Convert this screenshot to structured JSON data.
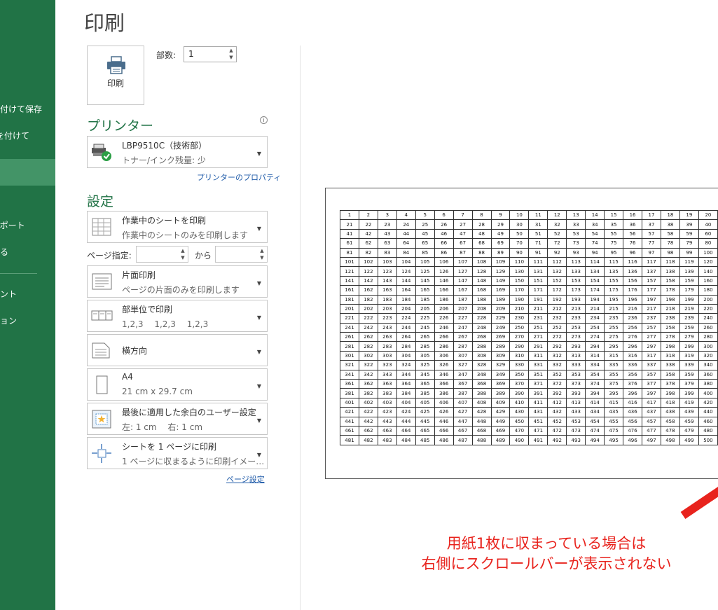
{
  "nav": {
    "items": [
      {
        "label": "名前を付けて保存",
        "active": false
      },
      {
        "label": "印刷を付けて",
        "active": false
      },
      {
        "label": "",
        "active": true
      },
      {
        "label": "エクスポート",
        "active": false
      },
      {
        "label": "閉じる",
        "active": false
      },
      {
        "label": "アカウント",
        "active": false
      },
      {
        "label": "オプション",
        "active": false
      }
    ]
  },
  "page_title": "印刷",
  "print_button": {
    "label": "印刷",
    "icon": "printer-icon"
  },
  "copies": {
    "label": "部数:",
    "value": "1"
  },
  "printer": {
    "heading": "プリンター",
    "name": "LBP9510C（技術部）",
    "status": "トナー/インク残量: 少",
    "properties_link": "プリンターのプロパティ"
  },
  "settings": {
    "heading": "設定",
    "what_to_print": {
      "title": "作業中のシートを印刷",
      "subtitle": "作業中のシートのみを印刷します"
    },
    "pages": {
      "label": "ページ指定:",
      "to_label": "から"
    },
    "sides": {
      "title": "片面印刷",
      "subtitle": "ページの片面のみを印刷します"
    },
    "collation": {
      "title": "部単位で印刷",
      "subtitle": "1,2,3　 1,2,3　 1,2,3"
    },
    "orientation": {
      "title": "横方向"
    },
    "paper_size": {
      "title": "A4",
      "subtitle": "21 cm x 29.7 cm"
    },
    "margins": {
      "title": "最後に適用した余白のユーザー設定",
      "subtitle": "左:  1 cm　 右:  1 cm"
    },
    "scaling": {
      "title": "シートを 1 ページに印刷",
      "subtitle": "1 ページに収まるように印刷イメー…"
    },
    "page_setup_link": "ページ設定"
  },
  "preview": {
    "rows": 25,
    "cols": 20
  },
  "annotation": {
    "line1": "用紙1枚に収まっている場合は",
    "line2": "右側にスクロールバーが表示されない",
    "color": "#e8231d"
  },
  "colors": {
    "accent": "#217346",
    "nav_active": "#439467"
  }
}
